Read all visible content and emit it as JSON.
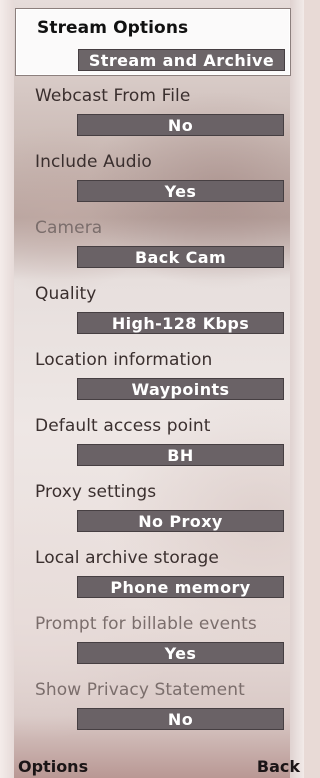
{
  "options": [
    {
      "label": "Stream Options",
      "value": "Stream and Archive",
      "selected": true,
      "dim": false
    },
    {
      "label": "Webcast From File",
      "value": "No",
      "selected": false,
      "dim": false
    },
    {
      "label": "Include Audio",
      "value": "Yes",
      "selected": false,
      "dim": false
    },
    {
      "label": "Camera",
      "value": "Back Cam",
      "selected": false,
      "dim": true
    },
    {
      "label": "Quality",
      "value": "High-128 Kbps",
      "selected": false,
      "dim": false
    },
    {
      "label": "Location information",
      "value": "Waypoints",
      "selected": false,
      "dim": false
    },
    {
      "label": "Default access point",
      "value": "BH",
      "selected": false,
      "dim": false
    },
    {
      "label": "Proxy settings",
      "value": "No Proxy",
      "selected": false,
      "dim": false
    },
    {
      "label": "Local archive storage",
      "value": "Phone memory",
      "selected": false,
      "dim": false
    },
    {
      "label": "Prompt for billable events",
      "value": "Yes",
      "selected": false,
      "dim": true
    },
    {
      "label": "Show Privacy Statement",
      "value": "No",
      "selected": false,
      "dim": true
    }
  ],
  "softkeys": {
    "left": "Options",
    "right": "Back"
  },
  "colors": {
    "value_box": "#6a6266",
    "selection": "#fbfafa"
  }
}
